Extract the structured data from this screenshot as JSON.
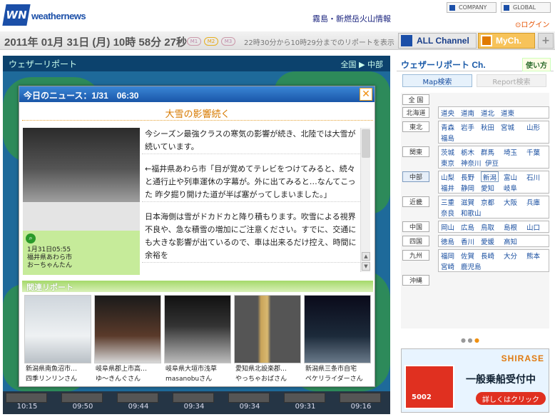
{
  "header": {
    "logo_mark": "WN",
    "logo_text": "weathernews",
    "volcano_link": "霧島・新燃岳火山情報",
    "company_label": "COMPANY",
    "global_label": "GLOBAL",
    "login": "ログイン"
  },
  "datebar": {
    "date": "2011年 01月 31日 (月) 10時 58分 27秒",
    "slots": [
      "M1",
      "M2",
      "M3"
    ],
    "range": "22時30分から10時29分までのリポートを表示",
    "all_channel": "ALL Channel",
    "mych": "MyCh.",
    "plus": "+"
  },
  "map": {
    "title": "ウェザーリポート",
    "nav": "全国 ▶ 中部",
    "times": [
      "10:15",
      "09:50",
      "09:44",
      "09:34",
      "09:34",
      "09:31",
      "09:16"
    ]
  },
  "modal": {
    "title": "今日のニュース：1/31　06:30",
    "close": "✕",
    "headline": "大雪の影響続く",
    "photo": {
      "date": "1月31日05:55",
      "place": "福井県あわら市",
      "user": "おーちゃんたん"
    },
    "paragraphs": [
      "今シーズン最強クラスの寒気の影響が続き、北陸では大雪が続いています。",
      "←福井県あわら市「目が覚めてテレビをつけてみると、続々と通行止や列車運休の字幕が。外に出てみると…なんてこった 昨夕掘り開けた道が半ば塞がってしまいました。」",
      "日本海側は雪がドカドカと降り積もります。吹雪による視界不良や、急な積雪の増加にご注意ください。すでに、交通にも大きな影響が出ているので、車は出来るだけ控え、時間に余裕を"
    ],
    "related_title": "関連リポート",
    "related": [
      {
        "place": "新潟県南魚沼市…",
        "user": "四季リンリンさん"
      },
      {
        "place": "岐阜県郡上市高…",
        "user": "ゆ～きんぐさん"
      },
      {
        "place": "岐阜県大垣市浅草",
        "user": "masanobuさん"
      },
      {
        "place": "愛知県北設楽郡…",
        "user": "やっちゃおばさん"
      },
      {
        "place": "新潟県三条市自宅",
        "user": "ペケリライダーさん"
      }
    ]
  },
  "sidebar": {
    "title": "ウェザーリポート Ch.",
    "beginner": "使い方",
    "tab_map": "Map検索",
    "tab_report": "Report検索",
    "regions": [
      {
        "name": "全 国",
        "prefs": []
      },
      {
        "name": "北海道",
        "prefs": [
          "道央",
          "道南",
          "道北",
          "道東"
        ]
      },
      {
        "name": "東北",
        "prefs": [
          "青森",
          "岩手",
          "秋田",
          "宮城",
          "山形",
          "福島"
        ]
      },
      {
        "name": "関東",
        "prefs": [
          "茨城",
          "栃木",
          "群馬",
          "埼玉",
          "千葉",
          "東京",
          "神奈川",
          "伊豆"
        ]
      },
      {
        "name": "中部",
        "prefs": [
          "山梨",
          "長野",
          "新潟",
          "富山",
          "石川",
          "福井",
          "静岡",
          "愛知",
          "岐阜"
        ]
      },
      {
        "name": "近畿",
        "prefs": [
          "三重",
          "滋賀",
          "京都",
          "大阪",
          "兵庫",
          "奈良",
          "和歌山"
        ]
      },
      {
        "name": "中国",
        "prefs": [
          "岡山",
          "広島",
          "鳥取",
          "島根",
          "山口"
        ]
      },
      {
        "name": "四国",
        "prefs": [
          "徳島",
          "香川",
          "愛媛",
          "高知"
        ]
      },
      {
        "name": "九州",
        "prefs": [
          "福岡",
          "佐賀",
          "長崎",
          "大分",
          "熊本",
          "宮崎",
          "鹿児島"
        ]
      },
      {
        "name": "沖縄",
        "prefs": []
      }
    ],
    "ad": {
      "brand": "SHIRASE",
      "ship_no": "5002",
      "headline": "一般乗船受付中",
      "button": "詳しくはクリック"
    }
  }
}
